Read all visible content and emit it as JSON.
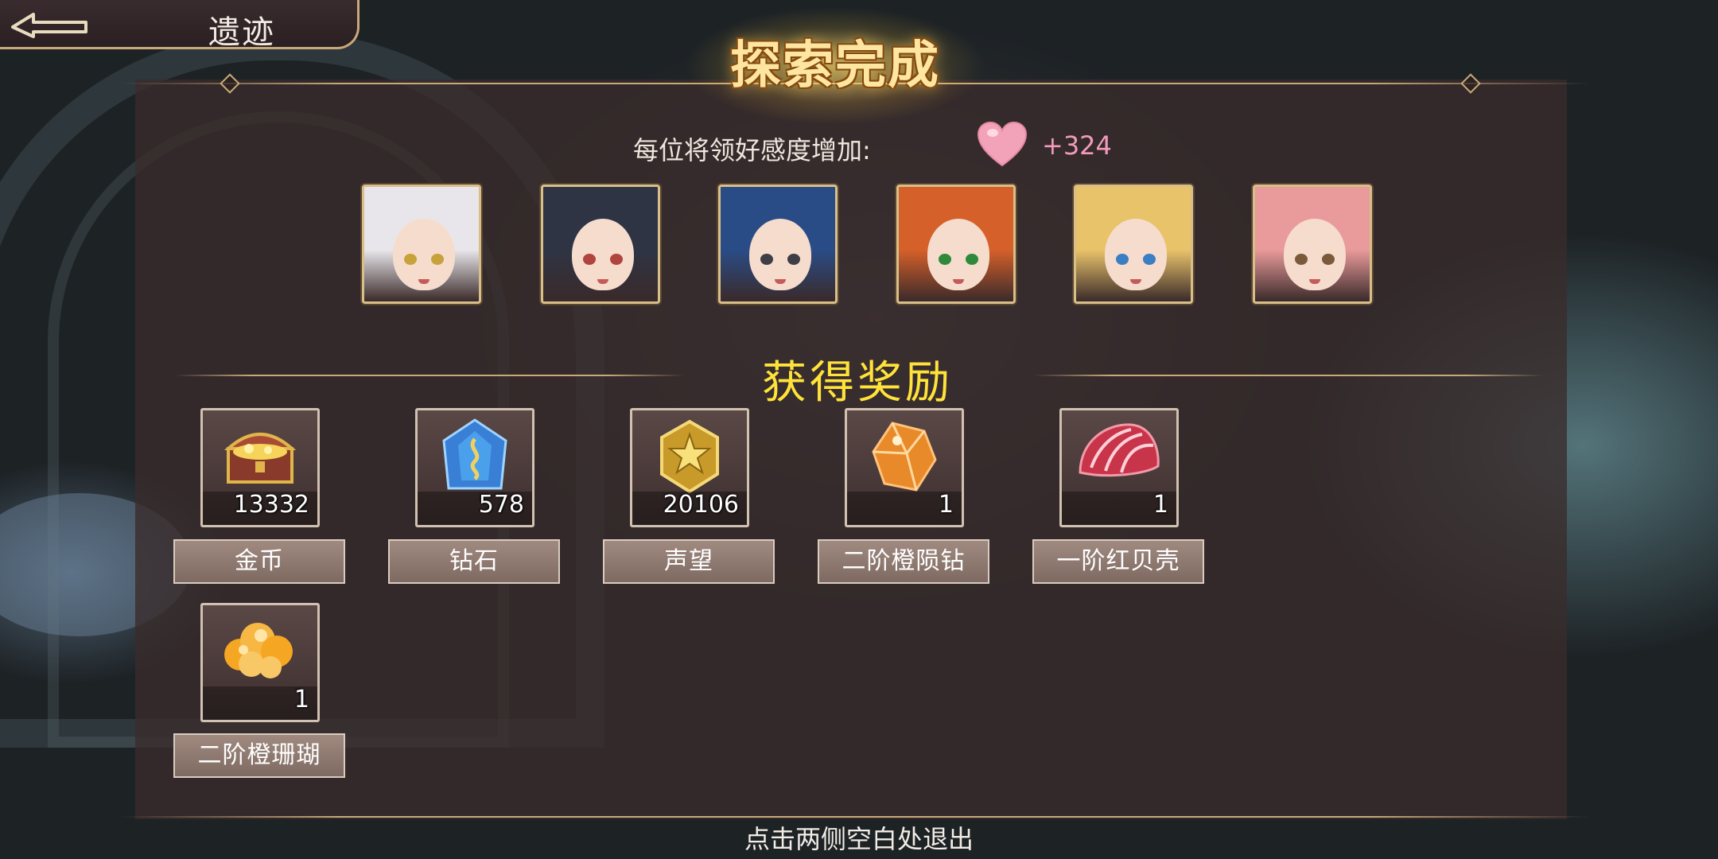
{
  "header": {
    "back_icon": "back-arrow-icon",
    "title": "遗迹"
  },
  "banner": {
    "title": "探索完成"
  },
  "affection": {
    "label": "每位将领好感度增加:",
    "icon": "heart-icon",
    "value": "+324",
    "color": "#f29bbd"
  },
  "portraits": [
    {
      "icon": "character-portrait-1",
      "hair": "#e8e6ea",
      "eye": "#c7a23a"
    },
    {
      "icon": "character-portrait-2",
      "hair": "#2e3444",
      "eye": "#b0443e"
    },
    {
      "icon": "character-portrait-3",
      "hair": "#2a4c86",
      "eye": "#3e3e46"
    },
    {
      "icon": "character-portrait-4",
      "hair": "#d5602a",
      "eye": "#2e8a3a"
    },
    {
      "icon": "character-portrait-5",
      "hair": "#e9c36a",
      "eye": "#3a7ec4"
    },
    {
      "icon": "character-portrait-6",
      "hair": "#e99a9a",
      "eye": "#7a5a3a"
    }
  ],
  "rewards": {
    "title": "获得奖励",
    "items": [
      {
        "name": "金币",
        "count": "13332",
        "icon": "treasure-chest-icon"
      },
      {
        "name": "钻石",
        "count": "578",
        "icon": "blue-diamond-icon"
      },
      {
        "name": "声望",
        "count": "20106",
        "icon": "prestige-badge-icon"
      },
      {
        "name": "二阶橙陨钻",
        "count": "1",
        "icon": "orange-crystal-icon"
      },
      {
        "name": "一阶红贝壳",
        "count": "1",
        "icon": "red-shell-icon"
      },
      {
        "name": "二阶橙珊瑚",
        "count": "1",
        "icon": "orange-coral-icon"
      }
    ]
  },
  "footer": {
    "hint": "点击两侧空白处退出"
  },
  "colors": {
    "gold": "#c9a979",
    "title_yellow": "#ffe23a",
    "panel": "#3a2c2c"
  }
}
